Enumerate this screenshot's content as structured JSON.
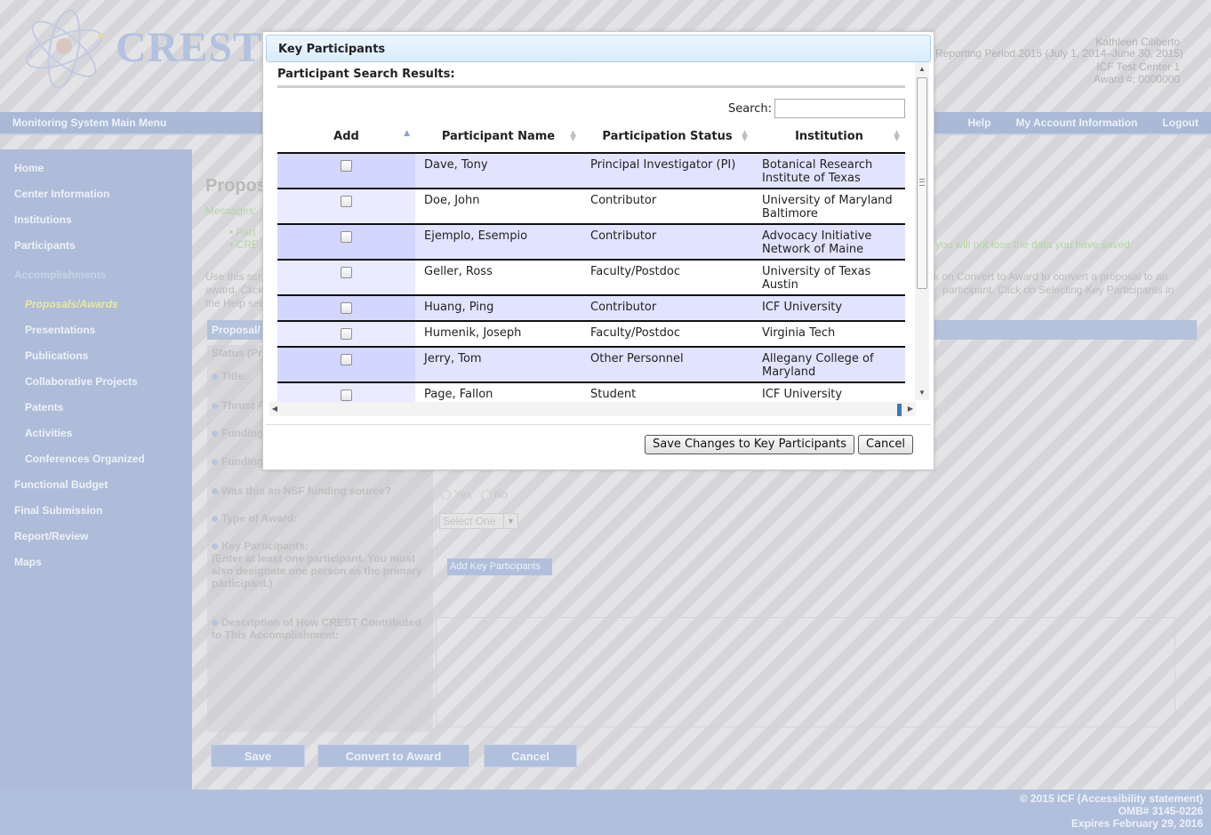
{
  "header": {
    "brand": "CRESTW",
    "user_name": "Kathleen Ciliberto",
    "reporting_period": "Reporting Period 2015 (July 1, 2014–June 30, 2015)",
    "center": "ICF Test Center 1",
    "award": "Award #: 0000000"
  },
  "navbar": {
    "main_menu": "Monitoring System Main Menu",
    "help": "Help",
    "account": "My Account Information",
    "logout": "Logout"
  },
  "sidebar": {
    "items": [
      {
        "label": "Home"
      },
      {
        "label": "Center Information"
      },
      {
        "label": "Institutions"
      },
      {
        "label": "Participants"
      },
      {
        "label": "Accomplishments"
      },
      {
        "label": "Proposals/Awards"
      },
      {
        "label": "Presentations"
      },
      {
        "label": "Publications"
      },
      {
        "label": "Collaborative Projects"
      },
      {
        "label": "Patents"
      },
      {
        "label": "Activities"
      },
      {
        "label": "Conferences Organized"
      },
      {
        "label": "Functional Budget"
      },
      {
        "label": "Final Submission"
      },
      {
        "label": "Report/Review"
      },
      {
        "label": "Maps"
      }
    ]
  },
  "page": {
    "title": "Propos",
    "messages_label": "Messages:",
    "msg1": "• Part",
    "msg2": "• CRE",
    "msg_right": "you will not lose the data you have saved.",
    "intro_left_1": "Use this scr",
    "intro_left_2": "award. Click",
    "intro_left_3": "the Help sec",
    "intro_right_1": "k on Convert to Award to convert a proposal to an",
    "intro_right_2": "participant. Click on Selecting Key Participants in",
    "section_title": "Proposal/",
    "status_label": "Status (Pr",
    "title_label": "Title:",
    "thrust_label": "Thrust A",
    "funding_label_1": "Funding",
    "funding_label_2": "Funding",
    "nsf_label": "Was this an NSF funding source?",
    "yes": "Yes",
    "no": "No",
    "award_type_label": "Type of Award:",
    "select_value": "Select One",
    "key_participants_label": "Key Participants:",
    "key_participants_note": "(Enter at least one participant. You must also designate one person as the primary participant.)",
    "add_kp_button": "Add Key Participants",
    "description_label": "Description of How CREST Contributed to This Accomplishment:",
    "save": "Save",
    "convert": "Convert to Award",
    "cancel": "Cancel"
  },
  "footer": {
    "line1": "© 2015 ICF (Accessibility statement)",
    "line2": "OMB# 3145-0226",
    "line3": "Expires February 29, 2016"
  },
  "modal": {
    "title": "Key Participants",
    "results_heading": "Participant Search Results:",
    "search_label": "Search:",
    "search_value": "",
    "columns": {
      "add": "Add",
      "name": "Participant Name",
      "status": "Participation Status",
      "institution": "Institution"
    },
    "rows": [
      {
        "name": "Dave, Tony",
        "status": "Principal Investigator (PI)",
        "institution": "Botanical Research Institute of Texas"
      },
      {
        "name": "Doe, John",
        "status": "Contributor",
        "institution": "University of Maryland Baltimore"
      },
      {
        "name": "Ejemplo, Esempio",
        "status": "Contributor",
        "institution": "Advocacy Initiative Network of Maine"
      },
      {
        "name": "Geller, Ross",
        "status": "Faculty/Postdoc",
        "institution": "University of Texas Austin"
      },
      {
        "name": "Huang, Ping",
        "status": "Contributor",
        "institution": "ICF University"
      },
      {
        "name": "Humenik, Joseph",
        "status": "Faculty/Postdoc",
        "institution": "Virginia Tech"
      },
      {
        "name": "Jerry, Tom",
        "status": "Other Personnel",
        "institution": "Allegany College of Maryland"
      },
      {
        "name": "Page, Fallon",
        "status": "Student",
        "institution": "ICF University"
      }
    ],
    "save_button": "Save Changes to Key Participants",
    "cancel_button": "Cancel"
  }
}
